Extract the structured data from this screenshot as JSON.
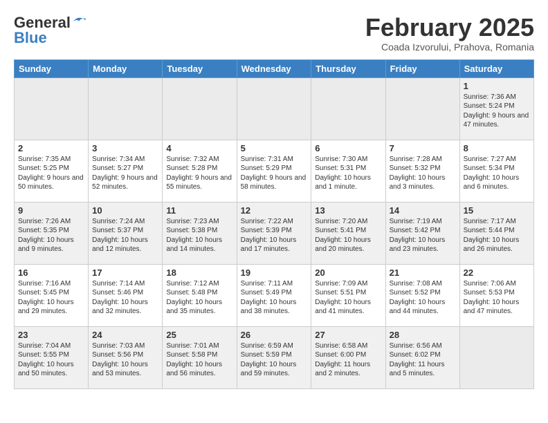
{
  "header": {
    "logo_general": "General",
    "logo_blue": "Blue",
    "month_title": "February 2025",
    "location": "Coada Izvorului, Prahova, Romania"
  },
  "calendar": {
    "weekdays": [
      "Sunday",
      "Monday",
      "Tuesday",
      "Wednesday",
      "Thursday",
      "Friday",
      "Saturday"
    ],
    "weeks": [
      [
        {
          "day": "",
          "info": ""
        },
        {
          "day": "",
          "info": ""
        },
        {
          "day": "",
          "info": ""
        },
        {
          "day": "",
          "info": ""
        },
        {
          "day": "",
          "info": ""
        },
        {
          "day": "",
          "info": ""
        },
        {
          "day": "1",
          "info": "Sunrise: 7:36 AM\nSunset: 5:24 PM\nDaylight: 9 hours and 47 minutes."
        }
      ],
      [
        {
          "day": "2",
          "info": "Sunrise: 7:35 AM\nSunset: 5:25 PM\nDaylight: 9 hours and 50 minutes."
        },
        {
          "day": "3",
          "info": "Sunrise: 7:34 AM\nSunset: 5:27 PM\nDaylight: 9 hours and 52 minutes."
        },
        {
          "day": "4",
          "info": "Sunrise: 7:32 AM\nSunset: 5:28 PM\nDaylight: 9 hours and 55 minutes."
        },
        {
          "day": "5",
          "info": "Sunrise: 7:31 AM\nSunset: 5:29 PM\nDaylight: 9 hours and 58 minutes."
        },
        {
          "day": "6",
          "info": "Sunrise: 7:30 AM\nSunset: 5:31 PM\nDaylight: 10 hours and 1 minute."
        },
        {
          "day": "7",
          "info": "Sunrise: 7:28 AM\nSunset: 5:32 PM\nDaylight: 10 hours and 3 minutes."
        },
        {
          "day": "8",
          "info": "Sunrise: 7:27 AM\nSunset: 5:34 PM\nDaylight: 10 hours and 6 minutes."
        }
      ],
      [
        {
          "day": "9",
          "info": "Sunrise: 7:26 AM\nSunset: 5:35 PM\nDaylight: 10 hours and 9 minutes."
        },
        {
          "day": "10",
          "info": "Sunrise: 7:24 AM\nSunset: 5:37 PM\nDaylight: 10 hours and 12 minutes."
        },
        {
          "day": "11",
          "info": "Sunrise: 7:23 AM\nSunset: 5:38 PM\nDaylight: 10 hours and 14 minutes."
        },
        {
          "day": "12",
          "info": "Sunrise: 7:22 AM\nSunset: 5:39 PM\nDaylight: 10 hours and 17 minutes."
        },
        {
          "day": "13",
          "info": "Sunrise: 7:20 AM\nSunset: 5:41 PM\nDaylight: 10 hours and 20 minutes."
        },
        {
          "day": "14",
          "info": "Sunrise: 7:19 AM\nSunset: 5:42 PM\nDaylight: 10 hours and 23 minutes."
        },
        {
          "day": "15",
          "info": "Sunrise: 7:17 AM\nSunset: 5:44 PM\nDaylight: 10 hours and 26 minutes."
        }
      ],
      [
        {
          "day": "16",
          "info": "Sunrise: 7:16 AM\nSunset: 5:45 PM\nDaylight: 10 hours and 29 minutes."
        },
        {
          "day": "17",
          "info": "Sunrise: 7:14 AM\nSunset: 5:46 PM\nDaylight: 10 hours and 32 minutes."
        },
        {
          "day": "18",
          "info": "Sunrise: 7:12 AM\nSunset: 5:48 PM\nDaylight: 10 hours and 35 minutes."
        },
        {
          "day": "19",
          "info": "Sunrise: 7:11 AM\nSunset: 5:49 PM\nDaylight: 10 hours and 38 minutes."
        },
        {
          "day": "20",
          "info": "Sunrise: 7:09 AM\nSunset: 5:51 PM\nDaylight: 10 hours and 41 minutes."
        },
        {
          "day": "21",
          "info": "Sunrise: 7:08 AM\nSunset: 5:52 PM\nDaylight: 10 hours and 44 minutes."
        },
        {
          "day": "22",
          "info": "Sunrise: 7:06 AM\nSunset: 5:53 PM\nDaylight: 10 hours and 47 minutes."
        }
      ],
      [
        {
          "day": "23",
          "info": "Sunrise: 7:04 AM\nSunset: 5:55 PM\nDaylight: 10 hours and 50 minutes."
        },
        {
          "day": "24",
          "info": "Sunrise: 7:03 AM\nSunset: 5:56 PM\nDaylight: 10 hours and 53 minutes."
        },
        {
          "day": "25",
          "info": "Sunrise: 7:01 AM\nSunset: 5:58 PM\nDaylight: 10 hours and 56 minutes."
        },
        {
          "day": "26",
          "info": "Sunrise: 6:59 AM\nSunset: 5:59 PM\nDaylight: 10 hours and 59 minutes."
        },
        {
          "day": "27",
          "info": "Sunrise: 6:58 AM\nSunset: 6:00 PM\nDaylight: 11 hours and 2 minutes."
        },
        {
          "day": "28",
          "info": "Sunrise: 6:56 AM\nSunset: 6:02 PM\nDaylight: 11 hours and 5 minutes."
        },
        {
          "day": "",
          "info": ""
        }
      ]
    ]
  }
}
